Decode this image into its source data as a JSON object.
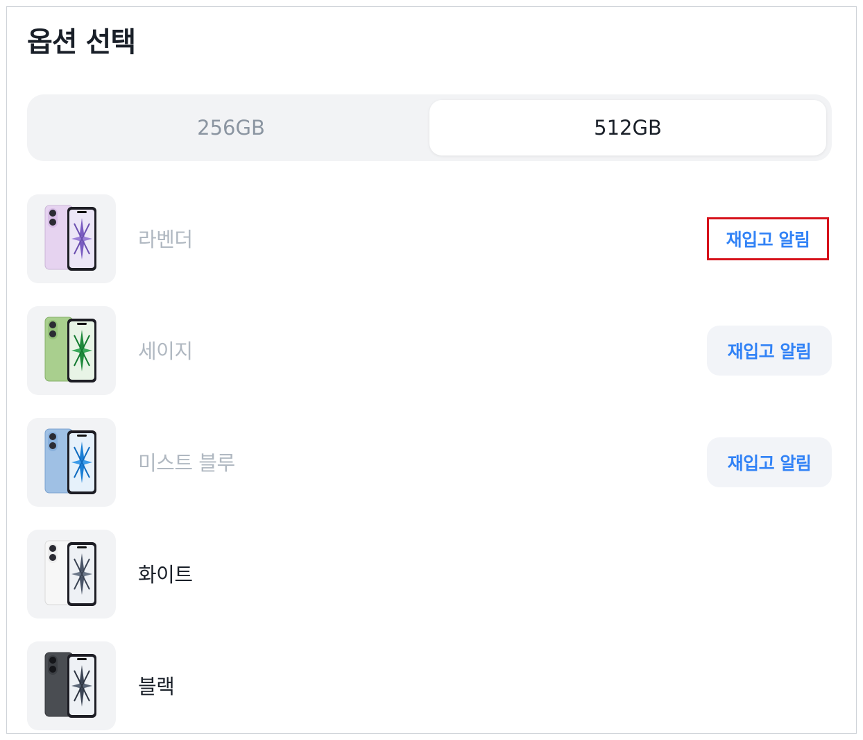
{
  "header": {
    "title": "옵션 선택"
  },
  "storage": {
    "options": [
      {
        "label": "256GB",
        "selected": false
      },
      {
        "label": "512GB",
        "selected": true
      }
    ]
  },
  "colors": [
    {
      "name": "라벤더",
      "in_stock": false,
      "restock_label": "재입고 알림",
      "body_color": "#e6d3f0",
      "icon": "phone-lavender-icon"
    },
    {
      "name": "세이지",
      "in_stock": false,
      "restock_label": "재입고 알림",
      "body_color": "#a9cf8e",
      "icon": "phone-sage-icon"
    },
    {
      "name": "미스트 블루",
      "in_stock": false,
      "restock_label": "재입고 알림",
      "body_color": "#9fc0e4",
      "icon": "phone-mist-blue-icon"
    },
    {
      "name": "화이트",
      "in_stock": true,
      "restock_label": "",
      "body_color": "#f5f5f5",
      "icon": "phone-white-icon"
    },
    {
      "name": "블랙",
      "in_stock": true,
      "restock_label": "",
      "body_color": "#4a4d52",
      "icon": "phone-black-icon"
    }
  ],
  "accent_color": "#3182f6",
  "highlight_color": "#d6121b"
}
